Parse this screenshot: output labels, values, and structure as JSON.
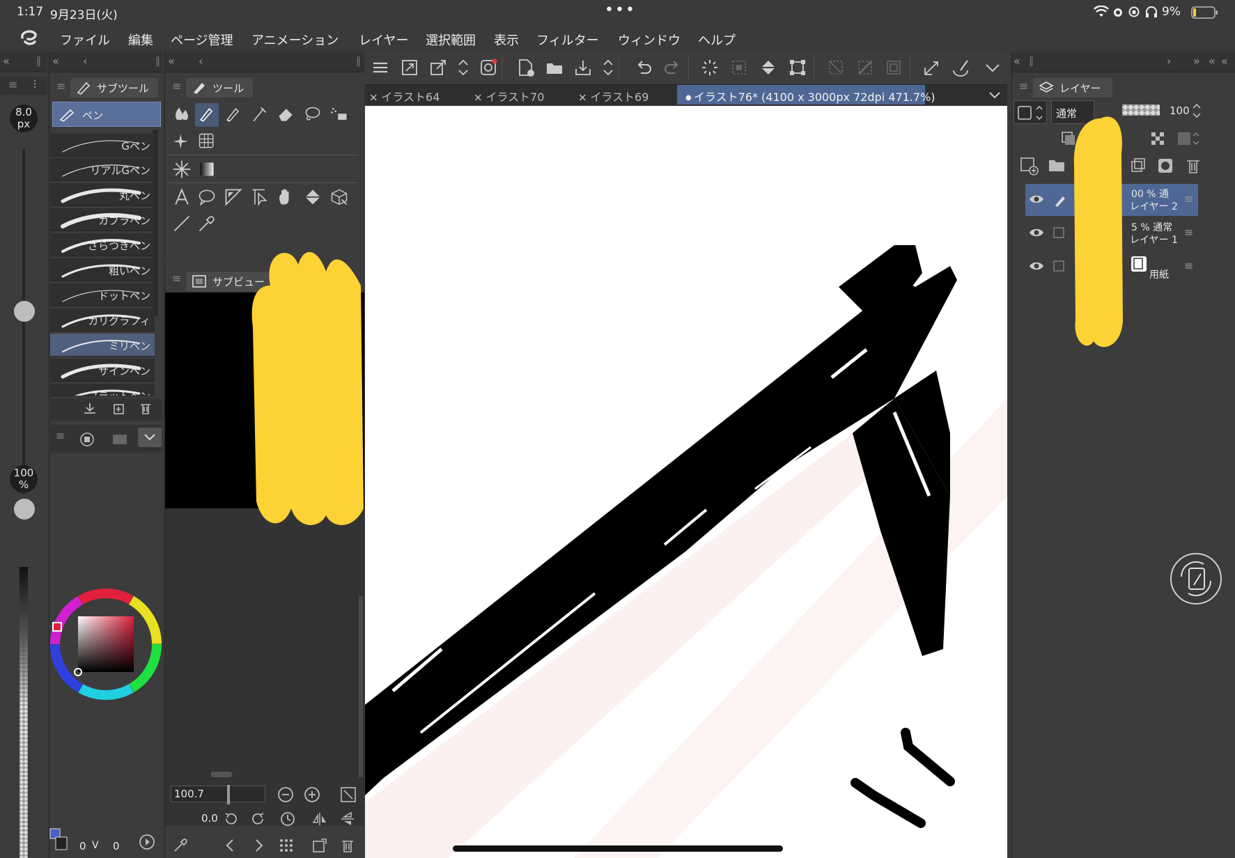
{
  "status_bar": {
    "time": "1:17",
    "date": "9月23日(火)",
    "dots": "•••",
    "battery": "9%"
  },
  "menu": {
    "items": [
      "ファイル",
      "編集",
      "ページ管理",
      "アニメーション",
      "レイヤー",
      "選択範囲",
      "表示",
      "フィルター",
      "ウィンドウ",
      "ヘルプ"
    ]
  },
  "left_strip": {
    "brush_size": "8.0",
    "brush_size_unit": "px",
    "opacity": "100",
    "opacity_unit": "%",
    "bottom_value_a": "0",
    "bottom_value_b": "0"
  },
  "subtool_panel": {
    "tab_label": "サブツール",
    "group_label": "ペン",
    "brushes": [
      {
        "label": "Gペン",
        "selected": false
      },
      {
        "label": "リアルGペン",
        "selected": false
      },
      {
        "label": "丸ペン",
        "selected": false
      },
      {
        "label": "カブラペン",
        "selected": false
      },
      {
        "label": "ざらつきペン",
        "selected": false
      },
      {
        "label": "粗いペン",
        "selected": false
      },
      {
        "label": "ドットペン",
        "selected": false
      },
      {
        "label": "カリグラフィ",
        "selected": false
      },
      {
        "label": "ミリペン",
        "selected": true
      },
      {
        "label": "サインペン",
        "selected": false
      },
      {
        "label": "フラットペン",
        "selected": false
      }
    ]
  },
  "tool_panel": {
    "tab_label": "ツール"
  },
  "subview_panel": {
    "tab_label": "サブビュー",
    "zoom_value": "100.7",
    "rotation_value": "0.0"
  },
  "doc_tabs": [
    {
      "label": "イラスト64",
      "active": false
    },
    {
      "label": "イラスト70",
      "active": false
    },
    {
      "label": "イラスト69",
      "active": false
    },
    {
      "label": "イラスト76* (4100 x 3000px 72dpi 471.7%)",
      "active": true
    }
  ],
  "layer_panel": {
    "tab_label": "レイヤー",
    "blend_mode": "通常",
    "opacity": "100",
    "layers": [
      {
        "line1": "00 % 通",
        "line2": "レイヤー 2",
        "selected": true
      },
      {
        "line1": "5 % 通常",
        "line2": "レイヤー 1",
        "selected": false
      },
      {
        "line1": "",
        "line2": "用紙",
        "selected": false
      }
    ]
  },
  "colors": {
    "background": "#3a3a3a",
    "panel": "#3c3c3c",
    "selection": "#4f6794",
    "redaction_yellow": "#fdd235",
    "canvas": "#ffffff"
  }
}
